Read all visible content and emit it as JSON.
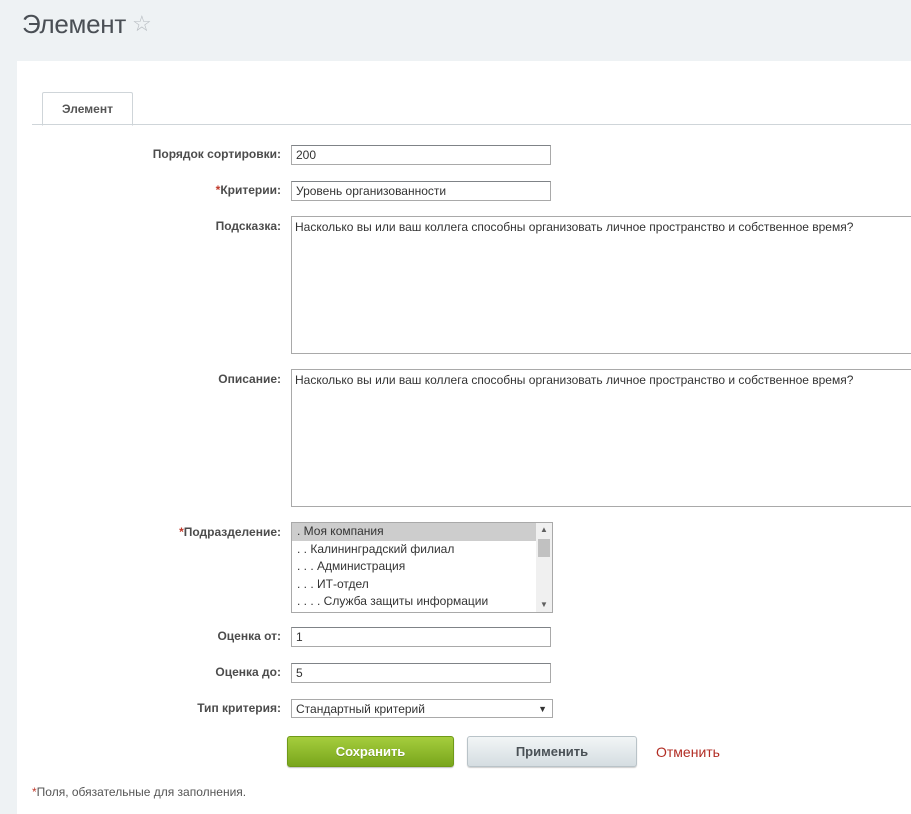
{
  "header": {
    "title": "Элемент",
    "star_icon": "star-icon"
  },
  "tabs": [
    {
      "label": "Элемент"
    }
  ],
  "form": {
    "sort": {
      "label": "Порядок сортировки:",
      "value": "200"
    },
    "criteria": {
      "required_mark": "*",
      "label": "Критерии:",
      "value": "Уровень организованности"
    },
    "hint": {
      "label": "Подсказка:",
      "value": "Насколько вы или ваш коллега способны организовать личное пространство и собственное время?"
    },
    "description": {
      "label": "Описание:",
      "value": "Насколько вы или ваш коллега способны организовать личное пространство и собственное время?"
    },
    "department": {
      "required_mark": "*",
      "label": "Подразделение:",
      "options": [
        {
          "text": ". Моя компания",
          "selected": true
        },
        {
          "text": ". . Калининградский филиал",
          "selected": false
        },
        {
          "text": ". . . Администрация",
          "selected": false
        },
        {
          "text": ". . . ИТ-отдел",
          "selected": false
        },
        {
          "text": ". . . . Служба защиты информации",
          "selected": false
        }
      ]
    },
    "score_from": {
      "label": "Оценка от:",
      "value": "1"
    },
    "score_to": {
      "label": "Оценка до:",
      "value": "5"
    },
    "criteria_type": {
      "label": "Тип критерия:",
      "value": "Стандартный критерий"
    }
  },
  "actions": {
    "save": "Сохранить",
    "apply": "Применить",
    "cancel": "Отменить"
  },
  "footnote": {
    "mark": "*",
    "text": "Поля, обязательные для заполнения."
  },
  "colors": {
    "save_button": "#8dbb2b",
    "cancel_link": "#b22d24",
    "required_mark": "#c0392b"
  }
}
